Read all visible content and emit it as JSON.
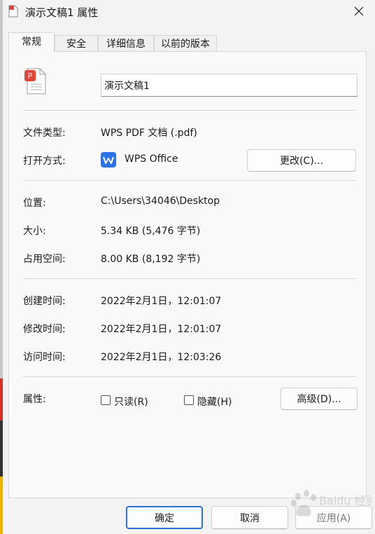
{
  "window": {
    "title": "演示文稿1 属性",
    "close_icon": "close-icon"
  },
  "tabs": [
    {
      "label": "常规",
      "active": true
    },
    {
      "label": "安全",
      "active": false
    },
    {
      "label": "详细信息",
      "active": false
    },
    {
      "label": "以前的版本",
      "active": false
    }
  ],
  "general": {
    "file_icon": "pdf-file-icon",
    "file_name": "演示文稿1",
    "file_type_label": "文件类型:",
    "file_type_value": "WPS PDF 文档 (.pdf)",
    "opens_with_label": "打开方式:",
    "opens_with_value": "WPS Office",
    "opens_with_icon": "wps-office-icon",
    "change_button": "更改(C)...",
    "location_label": "位置:",
    "location_value": "C:\\Users\\34046\\Desktop",
    "size_label": "大小:",
    "size_value": "5.34 KB (5,476 字节)",
    "size_on_disk_label": "占用空间:",
    "size_on_disk_value": "8.00 KB (8,192 字节)",
    "created_label": "创建时间:",
    "created_value": "2022年2月1日，12:01:07",
    "modified_label": "修改时间:",
    "modified_value": "2022年2月1日，12:01:07",
    "accessed_label": "访问时间:",
    "accessed_value": "2022年2月1日，12:03:26",
    "attributes_label": "属性:",
    "readonly_label": "只读(R)",
    "readonly_checked": false,
    "hidden_label": "隐藏(H)",
    "hidden_checked": false,
    "advanced_button": "高级(D)..."
  },
  "footer": {
    "ok_button": "确定",
    "cancel_button": "取消",
    "apply_button": "应用(A)"
  },
  "watermark_text": "Baidu 经验",
  "colors": {
    "accent": "#2d6fd6",
    "pdf_red": "#e0453a",
    "wps_blue": "#2b72e8"
  }
}
